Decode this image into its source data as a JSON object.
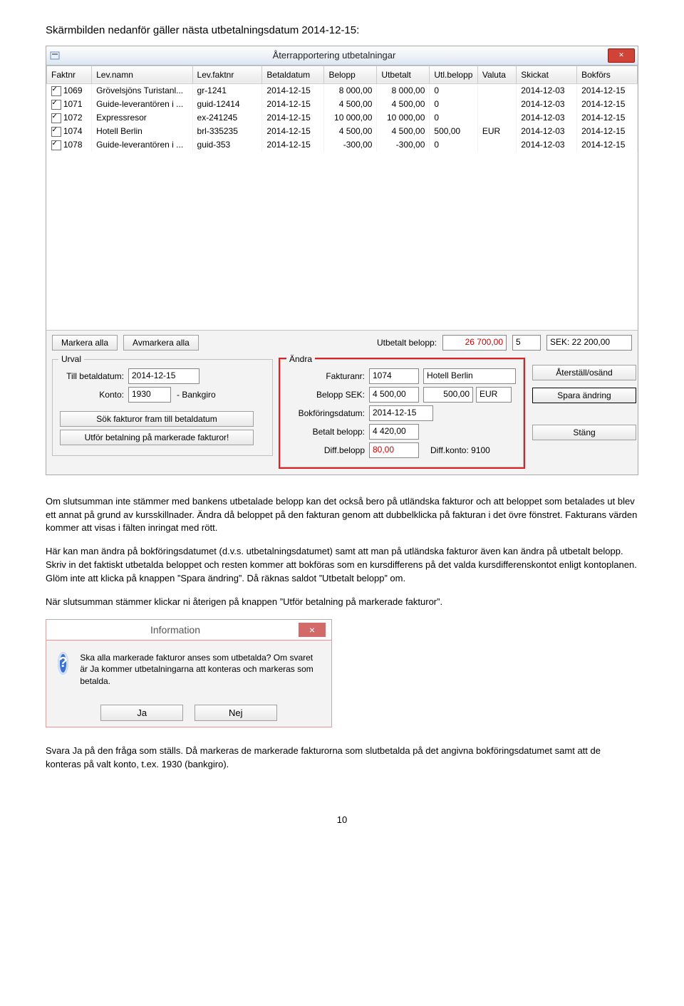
{
  "doc": {
    "top_line": "Skärmbilden nedanför gäller nästa utbetalningsdatum 2014-12-15:",
    "p1": "Om slutsumman inte stämmer med bankens utbetalade belopp kan det också bero på utländska fakturor och att beloppet som betalades ut blev ett annat på grund av kursskillnader. Ändra då beloppet på den fakturan genom att dubbelklicka på fakturan i det övre fönstret. Fakturans värden kommer att visas i fälten inringat med rött.",
    "p2": "Här kan man ändra på bokföringsdatumet (d.v.s. utbetalningsdatumet) samt att man på utländska fakturor även kan ändra på utbetalt belopp. Skriv in det faktiskt utbetalda beloppet och resten kommer att bokföras som en kursdifferens på det valda kursdifferenskontot enligt kontoplanen. Glöm inte att klicka på knappen ”Spara ändring”. Då räknas saldot ”Utbetalt belopp” om.",
    "p3": "När slutsumman stämmer klickar ni återigen på knappen ”Utför betalning på markerade fakturor”.",
    "p4": "Svara Ja på den fråga som ställs. Då markeras de markerade fakturorna som slutbetalda på det angivna bokföringsdatumet samt att de konteras på valt konto, t.ex. 1930 (bankgiro).",
    "pagenum": "10"
  },
  "win": {
    "title": "Återrapportering utbetalningar"
  },
  "cols": [
    "Faktnr",
    "Lev.namn",
    "Lev.faktnr",
    "Betaldatum",
    "Belopp",
    "Utbetalt",
    "Utl.belopp",
    "Valuta",
    "Skickat",
    "Bokförs"
  ],
  "rows": [
    {
      "c": true,
      "faktnr": "1069",
      "lev": "Grövelsjöns Turistanl...",
      "levf": "gr-1241",
      "betd": "2014-12-15",
      "bel": "8 000,00",
      "utb": "8 000,00",
      "ulb": "0",
      "val": "",
      "sk": "2014-12-03",
      "bok": "2014-12-15"
    },
    {
      "c": true,
      "faktnr": "1071",
      "lev": "Guide-leverantören i ...",
      "levf": "guid-12414",
      "betd": "2014-12-15",
      "bel": "4 500,00",
      "utb": "4 500,00",
      "ulb": "0",
      "val": "",
      "sk": "2014-12-03",
      "bok": "2014-12-15"
    },
    {
      "c": true,
      "faktnr": "1072",
      "lev": "Expressresor",
      "levf": "ex-241245",
      "betd": "2014-12-15",
      "bel": "10 000,00",
      "utb": "10 000,00",
      "ulb": "0",
      "val": "",
      "sk": "2014-12-03",
      "bok": "2014-12-15"
    },
    {
      "c": true,
      "faktnr": "1074",
      "lev": "Hotell Berlin",
      "levf": "brl-335235",
      "betd": "2014-12-15",
      "bel": "4 500,00",
      "utb": "4 500,00",
      "ulb": "500,00",
      "val": "EUR",
      "sk": "2014-12-03",
      "bok": "2014-12-15"
    },
    {
      "c": true,
      "faktnr": "1078",
      "lev": "Guide-leverantören i ...",
      "levf": "guid-353",
      "betd": "2014-12-15",
      "bel": "-300,00",
      "utb": "-300,00",
      "ulb": "0",
      "val": "",
      "sk": "2014-12-03",
      "bok": "2014-12-15"
    }
  ],
  "btns": {
    "mark_all": "Markera alla",
    "unmark_all": "Avmarkera alla",
    "utb_label": "Utbetalt belopp:",
    "utb_val": "26 700,00",
    "count": "5",
    "sek": "SEK: 22 200,00"
  },
  "urval": {
    "legend": "Urval",
    "till_label": "Till betaldatum:",
    "till_val": "2014-12-15",
    "konto_label": "Konto:",
    "konto_nr": "1930",
    "konto_name": "- Bankgiro",
    "sok": "Sök fakturor fram till betaldatum",
    "utfor": "Utför betalning på markerade fakturor!"
  },
  "andra": {
    "legend": "Ändra",
    "faktnr_l": "Fakturanr:",
    "faktnr_v": "1074",
    "faktnr_name": "Hotell Berlin",
    "belsek_l": "Belopp SEK:",
    "belsek_v": "4 500,00",
    "utl_v": "500,00",
    "val_v": "EUR",
    "bokd_l": "Bokföringsdatum:",
    "bokd_v": "2014-12-15",
    "betb_l": "Betalt belopp:",
    "betb_v": "4 420,00",
    "diffb_l": "Diff.belopp",
    "diffb_v": "80,00",
    "diffk": "Diff.konto: 9100"
  },
  "rbtns": {
    "restore": "Återställ/osänd",
    "save": "Spara ändring",
    "close": "Stäng"
  },
  "infodlg": {
    "title": "Information",
    "msg": "Ska alla markerade fakturor anses som utbetalda? Om svaret är Ja kommer utbetalningarna att konteras och markeras som betalda.",
    "yes": "Ja",
    "no": "Nej"
  }
}
